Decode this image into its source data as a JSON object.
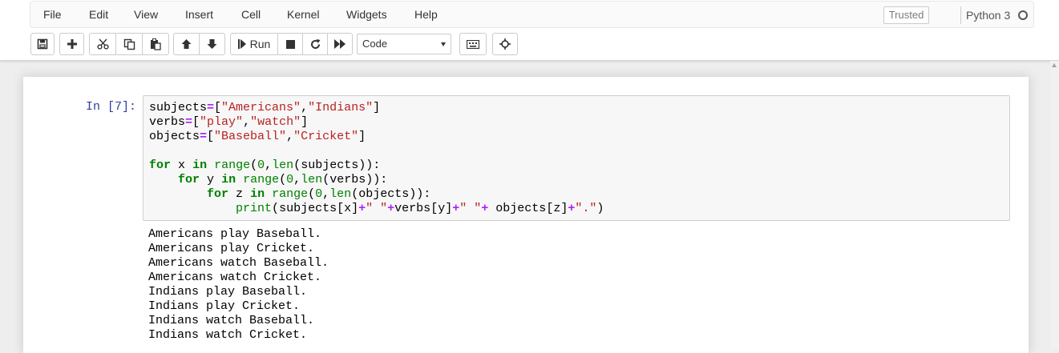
{
  "menubar": {
    "items": [
      "File",
      "Edit",
      "View",
      "Insert",
      "Cell",
      "Kernel",
      "Widgets",
      "Help"
    ],
    "trusted_label": "Trusted",
    "kernel_name": "Python 3"
  },
  "toolbar": {
    "buttons": [
      "save-icon",
      "plus-icon",
      "cut-icon",
      "copy-icon",
      "paste-icon",
      "arrow-up-icon",
      "arrow-down-icon",
      "run-icon",
      "stop-icon",
      "restart-icon",
      "fast-forward-icon",
      "keyboard-icon",
      "move-icon"
    ],
    "run_label": "Run",
    "cell_type": "Code"
  },
  "cell": {
    "prompt": "In [7]:",
    "code_lines": [
      "subjects=[\"Americans\",\"Indians\"]",
      "verbs=[\"play\",\"watch\"]",
      "objects=[\"Baseball\",\"Cricket\"]",
      "",
      "for x in range(0,len(subjects)):",
      "    for y in range(0,len(verbs)):",
      "        for z in range(0,len(objects)):",
      "            print(subjects[x]+\" \"+verbs[y]+\" \"+ objects[z]+\".\")"
    ],
    "output_lines": [
      "Americans play Baseball.",
      "Americans play Cricket.",
      "Americans watch Baseball.",
      "Americans watch Cricket.",
      "Indians play Baseball.",
      "Indians play Cricket.",
      "Indians watch Baseball.",
      "Indians watch Cricket."
    ]
  },
  "colors": {
    "keyword": "#008000",
    "operator": "#aa22ff",
    "string": "#ba2121",
    "prompt": "#303f9f"
  }
}
